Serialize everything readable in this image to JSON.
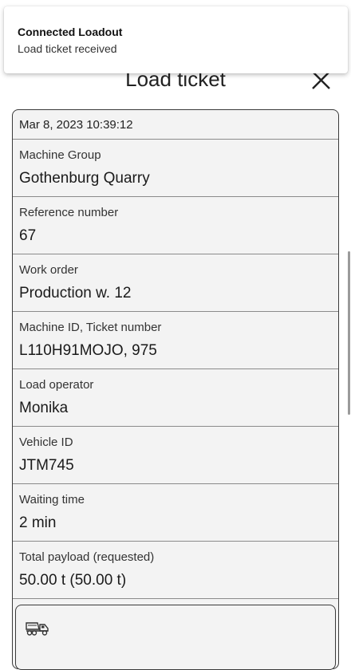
{
  "notification": {
    "title": "Connected Loadout",
    "message": "Load ticket received"
  },
  "header": {
    "title": "Load ticket",
    "close_icon": "close-icon"
  },
  "ticket": {
    "timestamp": "Mar 8, 2023 10:39:12",
    "fields": [
      {
        "label": "Machine Group",
        "value": "Gothenburg Quarry"
      },
      {
        "label": "Reference number",
        "value": "67"
      },
      {
        "label": "Work order",
        "value": "Production w. 12"
      },
      {
        "label": "Machine ID, Ticket number",
        "value": "L110H91MOJO, 975"
      },
      {
        "label": "Load operator",
        "value": "Monika"
      },
      {
        "label": "Vehicle ID",
        "value": "JTM745"
      },
      {
        "label": "Waiting time",
        "value": "2 min"
      },
      {
        "label": "Total payload (requested)",
        "value": "50.00 t (50.00 t)"
      }
    ]
  },
  "load_section": {
    "icon": "dump-truck-icon"
  }
}
